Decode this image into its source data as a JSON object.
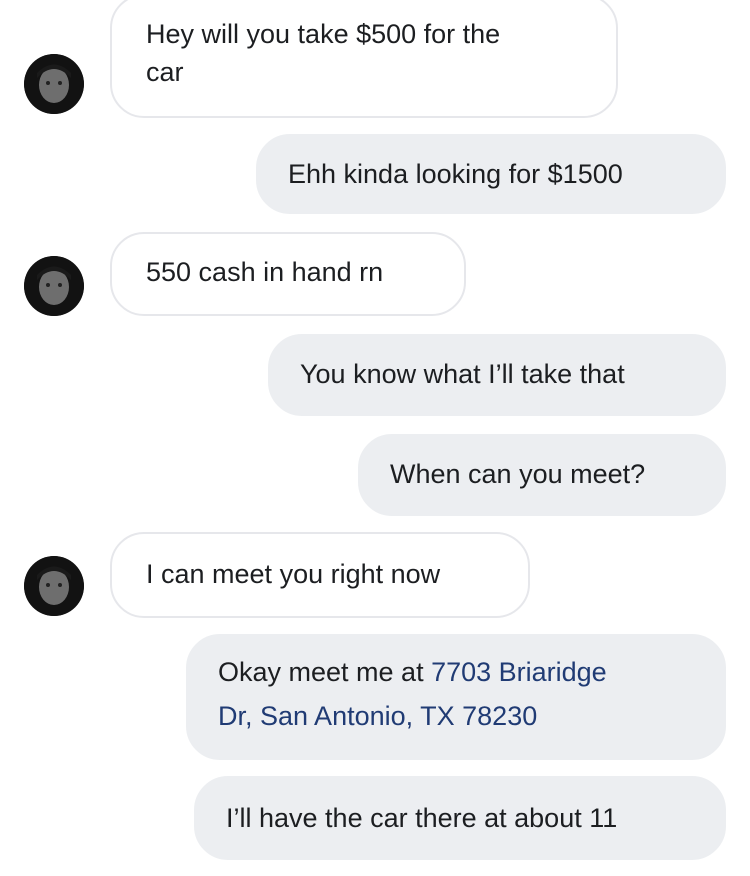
{
  "conversation": {
    "messages": [
      {
        "sender": "them",
        "text": "Hey will you take $500 for the car",
        "line1": "Hey will you take $500 for the",
        "line2": "car"
      },
      {
        "sender": "me",
        "text": "Ehh kinda looking for $1500"
      },
      {
        "sender": "them",
        "text": "550 cash in hand rn"
      },
      {
        "sender": "me",
        "text": "You know what I’ll take that"
      },
      {
        "sender": "me",
        "text": "When can you meet?"
      },
      {
        "sender": "them",
        "text": "I can meet you right now"
      },
      {
        "sender": "me",
        "prefix": "Okay meet me at ",
        "address_line1": "7703 Briaridge",
        "address_line2": "Dr, San Antonio, TX 78230"
      },
      {
        "sender": "me",
        "text": "I’ll have the car there at about 11"
      }
    ]
  },
  "colors": {
    "incoming_bubble": "#ffffff",
    "incoming_border": "#e6e7eb",
    "outgoing_bubble": "#eceef1",
    "text": "#1c1e21",
    "address_link": "#203b74"
  },
  "icons": {
    "avatar": "contact-avatar"
  }
}
